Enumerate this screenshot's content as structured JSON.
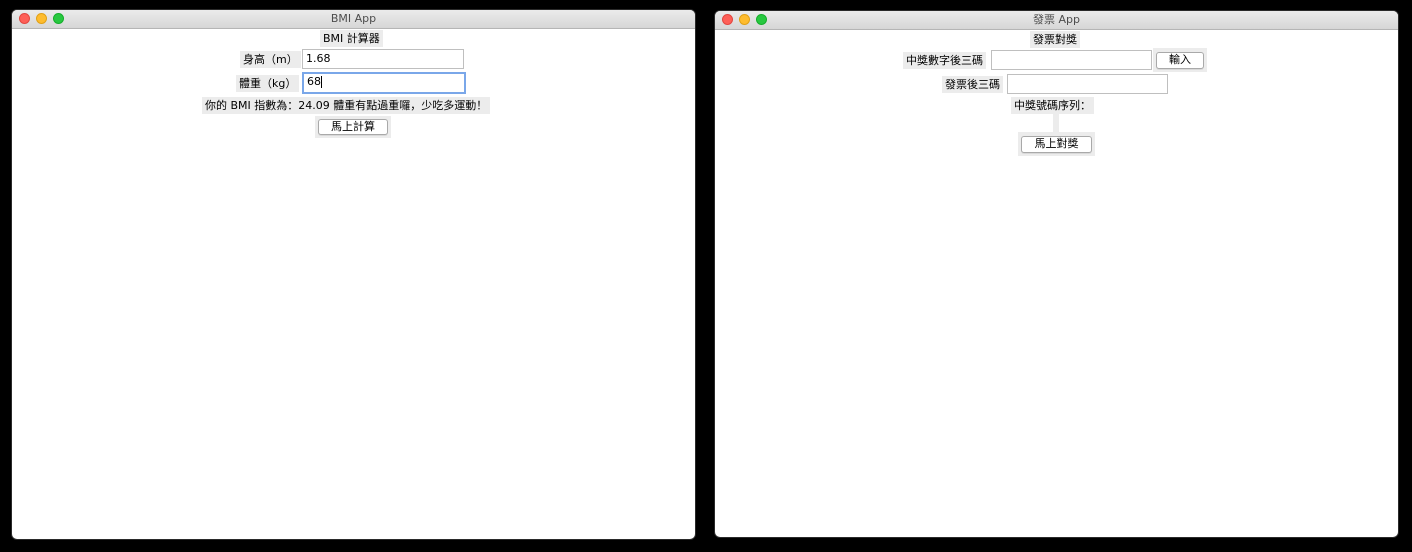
{
  "bmi_window": {
    "title": "BMI App",
    "heading": "BMI 計算器",
    "height_label": "身高（m）",
    "height_value": "1.68",
    "weight_label": "體重（kg）",
    "weight_value": "68",
    "result": "你的 BMI 指數為：24.09 體重有點過重囉，少吃多運動！",
    "calc_button": "馬上計算"
  },
  "invoice_window": {
    "title": "發票 App",
    "heading": "發票對獎",
    "winning_label": "中獎數字後三碼",
    "winning_value": "",
    "input_button": "輸入",
    "invoice_label": "發票後三碼",
    "invoice_value": "",
    "sequence_label": "中獎號碼序列：",
    "sequence_value": "",
    "check_button": "馬上對獎"
  }
}
